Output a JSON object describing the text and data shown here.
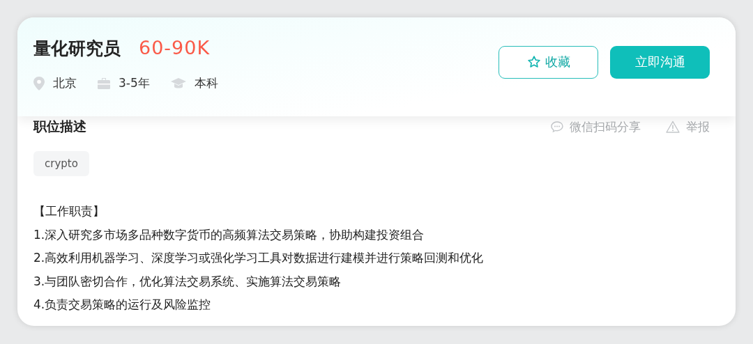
{
  "job": {
    "title": "量化研究员",
    "salary": "60-90K",
    "meta": [
      {
        "kind": "location",
        "text": "北京"
      },
      {
        "kind": "experience",
        "text": "3-5年"
      },
      {
        "kind": "education",
        "text": "本科"
      }
    ],
    "buttons": [
      {
        "kind": "outline",
        "label": "收藏"
      },
      {
        "kind": "primary",
        "label": "立即沟通"
      }
    ]
  },
  "description": {
    "heading": "职位描述",
    "actions": [
      {
        "kind": "share",
        "label": "微信扫码分享"
      },
      {
        "kind": "report",
        "label": "举报"
      }
    ],
    "tags": [
      "crypto"
    ],
    "lines": [
      "【工作职责】",
      "1.深入研究多市场多品种数字货币的高频算法交易策略，协助构建投资组合",
      "2.高效利用机器学习、深度学习或强化学习工具对数据进行建模并进行策略回测和优化",
      "3.与团队密切合作，优化算法交易系统、实施算法交易策略",
      "4.负责交易策略的运行及风险监控"
    ]
  }
}
